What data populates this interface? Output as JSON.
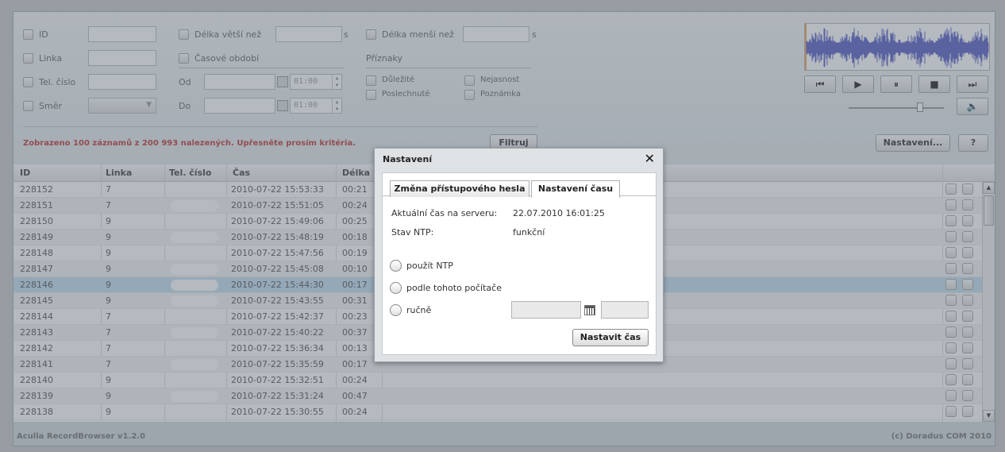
{
  "filters": {
    "id_label": "ID",
    "line_label": "Linka",
    "phone_label": "Tel. číslo",
    "direction_label": "Směr",
    "longer_label": "Délka větší než",
    "shorter_label": "Délka menší než",
    "seconds_unit": "s",
    "period_label": "Časové období",
    "from_label": "Od",
    "to_label": "Do",
    "from_time": "01:00",
    "to_time": "01:00",
    "flags_label": "Příznaky",
    "flag_important": "Důležité",
    "flag_unclear": "Nejasnost",
    "flag_listened": "Poslechnuté",
    "flag_note": "Poznámka",
    "filter_button": "Filtruj",
    "status_message": "Zobrazeno 100 záznamů z 200 993 nalezených. Upřesněte prosím kritéria."
  },
  "player": {
    "prev_icon": "⏮",
    "play_icon": "▶",
    "pause_icon": "⏸",
    "stop_icon": "■",
    "next_icon": "⏭",
    "volume_icon": "🔈",
    "volume_level": 0.7
  },
  "toolbar": {
    "settings_button": "Nastavení...",
    "help_button": "?"
  },
  "grid": {
    "columns": [
      "ID",
      "Linka",
      "Tel. číslo",
      "Čas",
      "Délka"
    ],
    "rows": [
      {
        "id": "228152",
        "line": "7",
        "time": "2010-07-22 15:53:33",
        "duration": "00:21"
      },
      {
        "id": "228151",
        "line": "7",
        "time": "2010-07-22 15:51:05",
        "duration": "00:24"
      },
      {
        "id": "228150",
        "line": "9",
        "time": "2010-07-22 15:49:06",
        "duration": "00:25"
      },
      {
        "id": "228149",
        "line": "9",
        "time": "2010-07-22 15:48:19",
        "duration": "00:18"
      },
      {
        "id": "228148",
        "line": "9",
        "time": "2010-07-22 15:47:56",
        "duration": "00:19"
      },
      {
        "id": "228147",
        "line": "9",
        "time": "2010-07-22 15:45:08",
        "duration": "00:10"
      },
      {
        "id": "228146",
        "line": "9",
        "time": "2010-07-22 15:44:30",
        "duration": "00:17"
      },
      {
        "id": "228145",
        "line": "9",
        "time": "2010-07-22 15:43:55",
        "duration": "00:31"
      },
      {
        "id": "228144",
        "line": "7",
        "time": "2010-07-22 15:42:37",
        "duration": "00:23"
      },
      {
        "id": "228143",
        "line": "7",
        "time": "2010-07-22 15:40:22",
        "duration": "00:37"
      },
      {
        "id": "228142",
        "line": "7",
        "time": "2010-07-22 15:36:34",
        "duration": "00:13"
      },
      {
        "id": "228141",
        "line": "7",
        "time": "2010-07-22 15:35:59",
        "duration": "00:17"
      },
      {
        "id": "228140",
        "line": "9",
        "time": "2010-07-22 15:32:51",
        "duration": "00:24"
      },
      {
        "id": "228139",
        "line": "9",
        "time": "2010-07-22 15:31:24",
        "duration": "00:47"
      },
      {
        "id": "228138",
        "line": "9",
        "time": "2010-07-22 15:30:55",
        "duration": "00:24"
      }
    ]
  },
  "footer": {
    "app_name": "Aculla RecordBrowser v1.2.0",
    "copyright": "(c) Doradus COM 2010"
  },
  "dialog": {
    "title": "Nastavení",
    "close_icon": "✕",
    "tabs": [
      {
        "label": "Změna přístupového hesla",
        "active": false
      },
      {
        "label": "Nastavení času",
        "active": true
      }
    ],
    "server_time_label": "Aktuální čas na serveru:",
    "server_time_value": "22.07.2010 16:01:25",
    "ntp_status_label": "Stav NTP:",
    "ntp_status_value": "funkční",
    "option_ntp": "použít NTP",
    "option_computer": "podle tohoto počítače",
    "option_manual": "ručně",
    "set_button": "Nastavit čas"
  },
  "colors": {
    "warning_text": "#c23a3a",
    "selected_row": "#c7def2",
    "waveform": "#5b5fc7",
    "overlay": "#586671"
  }
}
